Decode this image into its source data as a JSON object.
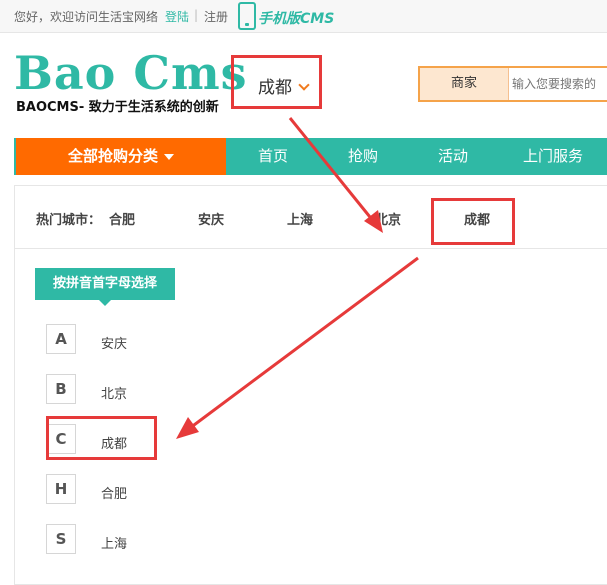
{
  "topbar": {
    "greeting": "您好，欢迎访问生活宝网络",
    "login": "登陆",
    "separator": "|",
    "register": "注册",
    "mobile_label": "手机版CMS"
  },
  "header": {
    "logo": "Bao Cms",
    "slogan": "BAOCMS- 致力于生活系统的创新",
    "current_city": "成都",
    "search_tab": "商家",
    "search_placeholder": "输入您要搜索的"
  },
  "nav": {
    "all_categories": "全部抢购分类",
    "items": [
      "首页",
      "抢购",
      "活动",
      "上门服务"
    ]
  },
  "hot_cities": {
    "label": "热门城市：",
    "cities": [
      "合肥",
      "安庆",
      "上海",
      "北京",
      "成都"
    ]
  },
  "pinyin": {
    "button": "按拼音首字母选择",
    "groups": [
      {
        "letter": "A",
        "city": "安庆"
      },
      {
        "letter": "B",
        "city": "北京"
      },
      {
        "letter": "C",
        "city": "成都"
      },
      {
        "letter": "H",
        "city": "合肥"
      },
      {
        "letter": "S",
        "city": "上海"
      }
    ]
  },
  "colors": {
    "brand": "#2fb9a5",
    "accent": "#ff6a00",
    "annotation": "#e63a3a"
  }
}
